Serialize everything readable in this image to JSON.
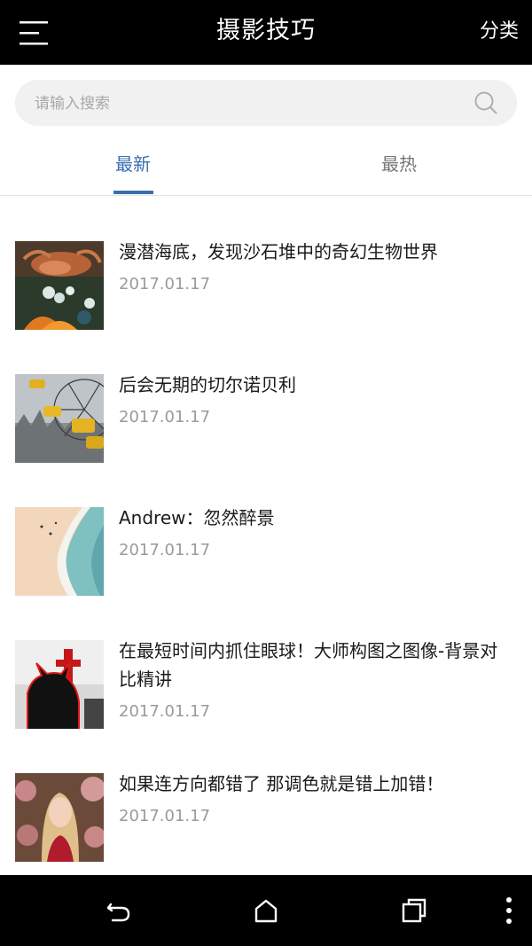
{
  "app_bar": {
    "title": "摄影技巧",
    "right_action": "分类",
    "menu_icon": "menu-icon"
  },
  "search": {
    "placeholder": "请输入搜索",
    "value": "",
    "icon": "search-icon"
  },
  "tabs": [
    {
      "label": "最新",
      "active": true
    },
    {
      "label": "最热",
      "active": false
    }
  ],
  "articles": [
    {
      "title": "漫潜海底，发现沙石堆中的奇幻生物世界",
      "date": "2017.01.17",
      "thumb": "crab-underwater"
    },
    {
      "title": "后会无期的切尔诺贝利",
      "date": "2017.01.17",
      "thumb": "ferris-wheel"
    },
    {
      "title": "Andrew：忽然醉景",
      "date": "2017.01.17",
      "thumb": "beach-waves"
    },
    {
      "title": "在最短时间内抓住眼球！大师构图之图像-背景对比精讲",
      "date": "2017.01.17",
      "thumb": "devil-silhouette"
    },
    {
      "title": "如果连方向都错了 那调色就是错上加错！",
      "date": "2017.01.17",
      "thumb": "woman-portrait"
    }
  ],
  "colors": {
    "accent": "#3a6eb0",
    "bar": "#000000",
    "muted": "#9a9a9a"
  },
  "system_nav": [
    "back-icon",
    "home-icon",
    "recents-icon",
    "more-icon"
  ]
}
